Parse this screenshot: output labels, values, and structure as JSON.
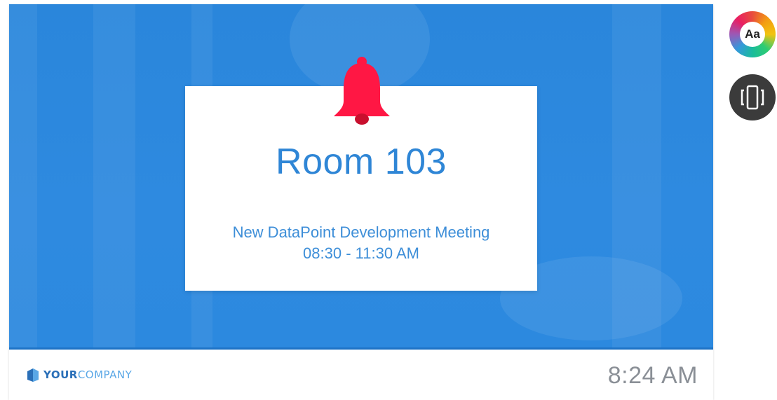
{
  "card": {
    "room": "Room 103",
    "meeting_name": "New DataPoint Development Meeting",
    "meeting_time": "08:30 - 11:30 AM"
  },
  "footer": {
    "logo_bold": "YOUR",
    "logo_light": "COMPANY",
    "clock": "8:24 AM"
  },
  "side_buttons": {
    "theme_label": "Aa"
  },
  "icons": {
    "bell": "bell-icon",
    "logo": "company-logo-icon",
    "theme": "color-wheel-icon",
    "rotate": "device-rotate-icon"
  },
  "colors": {
    "hero_blue": "#2e8ae0",
    "bell_red": "#ff1744",
    "title_blue": "#2f86d6",
    "clock_gray": "#8a8f96",
    "button_dark": "#3b3b3b"
  }
}
